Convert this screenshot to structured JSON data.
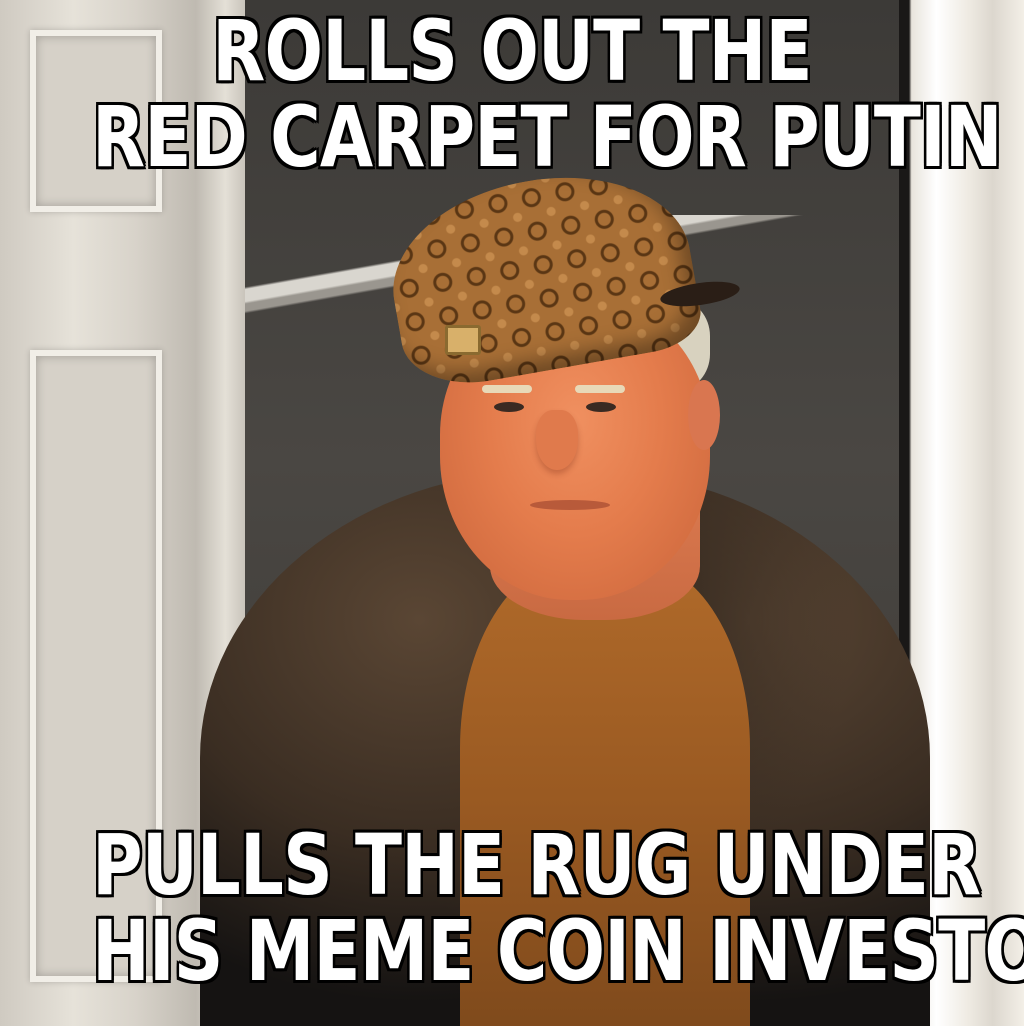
{
  "meme": {
    "top_text": [
      "ROLLS OUT THE",
      "RED CARPET FOR PUTIN"
    ],
    "bottom_text": [
      "PULLS THE RUG UNDER",
      "HIS MEME COIN INVESTORS"
    ]
  },
  "colors": {
    "caption_fill": "#ffffff",
    "caption_outline": "#000000",
    "shirt": "#9a5a22",
    "cap": "#a86f36"
  }
}
